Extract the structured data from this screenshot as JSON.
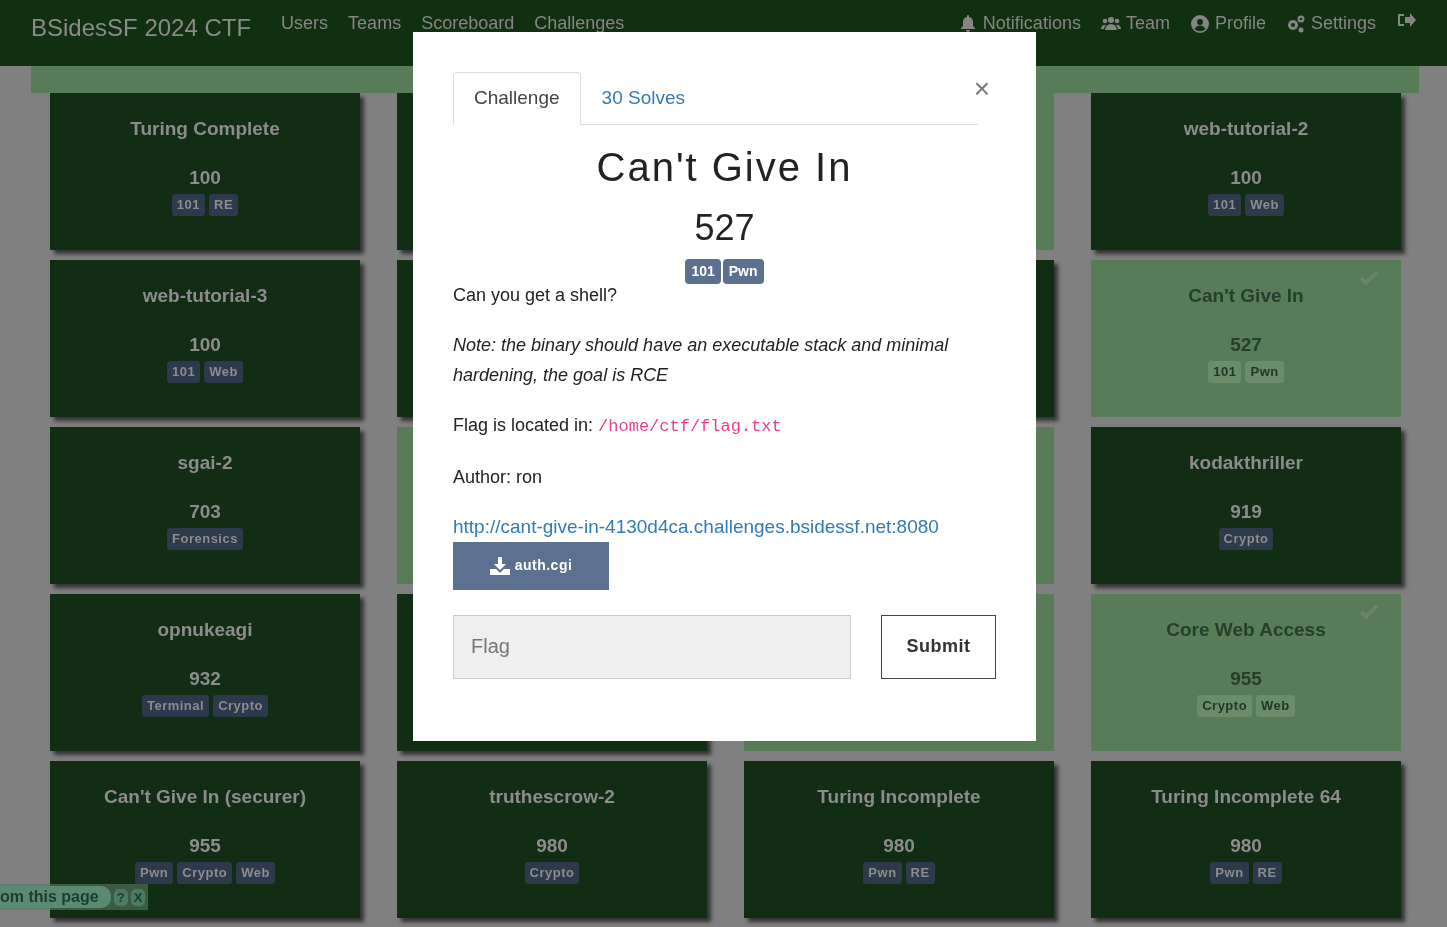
{
  "navbar": {
    "brand": "BSidesSF 2024 CTF",
    "links": [
      {
        "label": "Users"
      },
      {
        "label": "Teams"
      },
      {
        "label": "Scoreboard"
      },
      {
        "label": "Challenges"
      }
    ],
    "right": [
      {
        "label": "Notifications"
      },
      {
        "label": "Team"
      },
      {
        "label": "Profile"
      },
      {
        "label": "Settings"
      }
    ]
  },
  "cards": [
    {
      "name": "Turing Complete",
      "value": "100",
      "tags": [
        "101",
        "RE"
      ],
      "solved": false
    },
    {
      "solved": false
    },
    {
      "solved": true
    },
    {
      "name": "web-tutorial-2",
      "value": "100",
      "tags": [
        "101",
        "Web"
      ],
      "solved": false
    },
    {
      "name": "web-tutorial-3",
      "value": "100",
      "tags": [
        "101",
        "Web"
      ],
      "solved": false
    },
    {
      "solved": false
    },
    {
      "solved": false
    },
    {
      "name": "Can't Give In",
      "value": "527",
      "tags": [
        "101",
        "Pwn"
      ],
      "solved": true
    },
    {
      "name": "sgai-2",
      "value": "703",
      "tags": [
        "Forensics"
      ],
      "solved": false
    },
    {
      "solved": true
    },
    {
      "solved": true
    },
    {
      "name": "kodakthriller",
      "value": "919",
      "tags": [
        "Crypto"
      ],
      "solved": false
    },
    {
      "name": "opnukeagi",
      "value": "932",
      "tags": [
        "Terminal",
        "Crypto"
      ],
      "solved": false
    },
    {
      "solved": false
    },
    {
      "solved": true
    },
    {
      "name": "Core Web Access",
      "value": "955",
      "tags": [
        "Crypto",
        "Web"
      ],
      "solved": true
    },
    {
      "name": "Can't Give In (securer)",
      "value": "955",
      "tags": [
        "Pwn",
        "Crypto",
        "Web"
      ],
      "solved": false
    },
    {
      "name": "truthescrow-2",
      "value": "980",
      "tags": [
        "Crypto"
      ],
      "solved": false
    },
    {
      "name": "Turing Incomplete",
      "value": "980",
      "tags": [
        "Pwn",
        "RE"
      ],
      "solved": false
    },
    {
      "name": "Turing Incomplete 64",
      "value": "980",
      "tags": [
        "Pwn",
        "RE"
      ],
      "solved": false
    }
  ],
  "modal": {
    "tabs": [
      {
        "label": "Challenge",
        "selected": true
      },
      {
        "label": "30 Solves",
        "selected": false
      }
    ],
    "close": "×",
    "title": "Can't Give In",
    "value": "527",
    "tags": [
      "101",
      "Pwn"
    ],
    "description": [
      {
        "kind": "text",
        "text": "Can you get a shell?"
      },
      {
        "kind": "italic",
        "text": "Note: the binary should have an executable stack and minimal hardening, the goal is RCE"
      },
      {
        "kind": "code",
        "text": "Flag is located in: ",
        "code": "/home/ctf/flag.txt"
      },
      {
        "kind": "text",
        "text": "Author: ron"
      },
      {
        "kind": "link",
        "text": "http://cant-give-in-4130d4ca.challenges.bsidessf.net:8080"
      }
    ],
    "file": "auth.cgi",
    "flag_placeholder": "Flag",
    "submit": "Submit"
  },
  "translate_bar": {
    "text": "om this page",
    "help": "?",
    "close": "X"
  }
}
